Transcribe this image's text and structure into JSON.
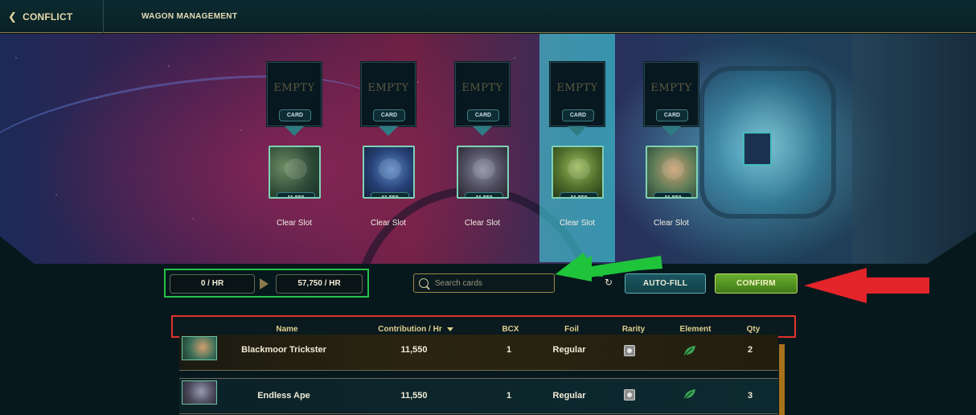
{
  "topbar": {
    "back_label": "CONFLICT",
    "title": "WAGON MANAGEMENT"
  },
  "slots": [
    {
      "empty_label": "EMPTY",
      "card_tag": "CARD",
      "power": "11,550",
      "clear_label": "Clear Slot"
    },
    {
      "empty_label": "EMPTY",
      "card_tag": "CARD",
      "power": "11,550",
      "clear_label": "Clear Slot"
    },
    {
      "empty_label": "EMPTY",
      "card_tag": "CARD",
      "power": "11,550",
      "clear_label": "Clear Slot"
    },
    {
      "empty_label": "EMPTY",
      "card_tag": "CARD",
      "power": "11,550",
      "clear_label": "Clear Slot"
    },
    {
      "empty_label": "EMPTY",
      "card_tag": "CARD",
      "power": "11,550",
      "clear_label": "Clear Slot"
    }
  ],
  "rates": {
    "current": "0 / HR",
    "max": "57,750 / HR"
  },
  "search": {
    "placeholder": "Search cards"
  },
  "buttons": {
    "autofill": "AUTO-FILL",
    "confirm": "CONFIRM"
  },
  "table": {
    "headers": {
      "name": "Name",
      "contribution": "Contribution / Hr",
      "bcx": "BCX",
      "foil": "Foil",
      "rarity": "Rarity",
      "element": "Element",
      "qty": "Qty"
    },
    "rows": [
      {
        "name": "Blackmoor Trickster",
        "contribution": "11,550",
        "bcx": "1",
        "foil": "Regular",
        "qty": "2"
      },
      {
        "name": "Endless Ape",
        "contribution": "11,550",
        "bcx": "1",
        "foil": "Regular",
        "qty": "3"
      }
    ]
  },
  "colors": {
    "accent_gold": "#dfcf8f",
    "confirm_green": "#5b9a25",
    "autofill_teal": "#1b5862",
    "annotation_green": "#27c24a",
    "annotation_red": "#e0322c"
  }
}
